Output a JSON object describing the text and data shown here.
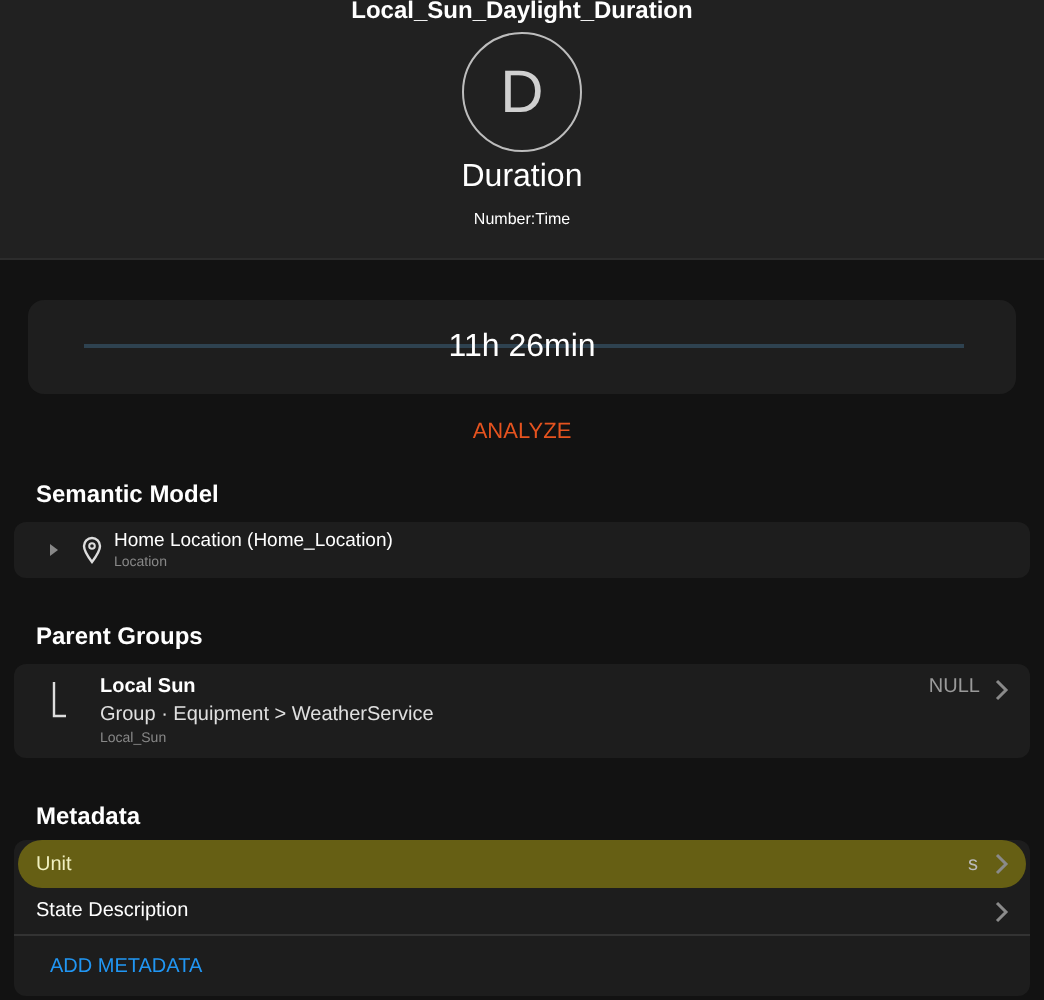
{
  "header": {
    "title": "Local_Sun_Daylight_Duration",
    "avatar_letter": "D",
    "label": "Duration",
    "type": "Number:Time"
  },
  "state": {
    "value": "11h 26min"
  },
  "analyze_button": "ANALYZE",
  "semantic_model": {
    "heading": "Semantic Model",
    "items": [
      {
        "title": "Home Location (Home_Location)",
        "subtitle": "Location",
        "expanded": false
      }
    ]
  },
  "parent_groups": {
    "heading": "Parent Groups",
    "items": [
      {
        "title": "Local Sun",
        "subtitle": "Group · Equipment > WeatherService",
        "name": "Local_Sun",
        "state": "NULL"
      }
    ]
  },
  "metadata": {
    "heading": "Metadata",
    "items": [
      {
        "label": "Unit",
        "value": "s",
        "highlighted": true
      },
      {
        "label": "State Description",
        "highlighted": false
      }
    ],
    "add_button": "ADD METADATA"
  }
}
